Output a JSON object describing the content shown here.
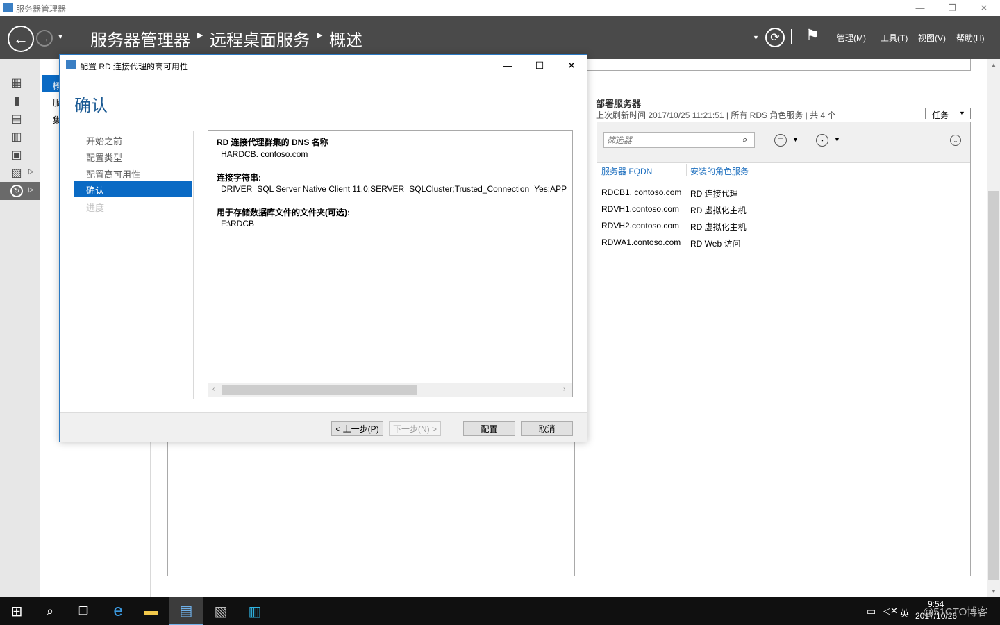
{
  "window": {
    "title": "服务器管理器",
    "controls": {
      "minimize": "—",
      "restore": "❐",
      "close": "✕"
    }
  },
  "header": {
    "breadcrumb": [
      "服务器管理器",
      "远程桌面服务",
      "概述"
    ],
    "menu": [
      "管理(M)",
      "工具(T)",
      "视图(V)",
      "帮助(H)"
    ]
  },
  "nav": {
    "item_selected_abbr": "概",
    "items_abbr": [
      "服",
      "集"
    ]
  },
  "deploy": {
    "title": "部署服务器",
    "refresh": "上次刷新时间 2017/10/25 11:21:51 | 所有 RDS 角色服务 | 共 4 个",
    "tasks": "任务",
    "filter_placeholder": "筛选器",
    "columns": [
      "服务器 FQDN",
      "安装的角色服务"
    ],
    "rows": [
      [
        "RDCB1. contoso.com",
        "RD 连接代理"
      ],
      [
        "RDVH1.contoso.com",
        "RD 虚拟化主机"
      ],
      [
        "RDVH2.contoso.com",
        "RD 虚拟化主机"
      ],
      [
        "RDWA1.contoso.com",
        "RD Web 访问"
      ]
    ]
  },
  "dialog": {
    "title": "配置 RD 连接代理的高可用性",
    "heading": "确认",
    "steps": [
      "开始之前",
      "配置类型",
      "配置高可用性",
      "确认",
      "进度"
    ],
    "fields": [
      {
        "label": "RD 连接代理群集的 DNS 名称",
        "value": "HARDCB. contoso.com"
      },
      {
        "label": "连接字符串:",
        "value": "DRIVER=SQL Server Native Client 11.0;SERVER=SQLCluster;Trusted_Connection=Yes;APP"
      },
      {
        "label": "用于存储数据库文件的文件夹(可选):",
        "value": "F:\\RDCB"
      }
    ],
    "buttons": {
      "prev": "< 上一步(P)",
      "next": "下一步(N) >",
      "configure": "配置",
      "cancel": "取消"
    }
  },
  "taskbar": {
    "ime": "英",
    "time": "9:54",
    "date": "2017/10/26",
    "watermark": "@51CTO博客"
  }
}
